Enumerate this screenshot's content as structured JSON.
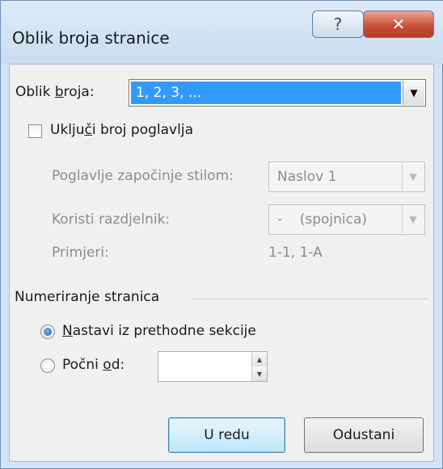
{
  "window": {
    "title": "Oblik broja stranice",
    "help_glyph": "?",
    "close_glyph": "✕"
  },
  "number_format": {
    "label_pre": "Oblik ",
    "label_u": "b",
    "label_post": "roja:",
    "value": "1, 2, 3, ...",
    "arrow": "▼"
  },
  "include_chapter": {
    "label_pre": "Uklju",
    "label_u": "č",
    "label_post": "i broj poglavlja",
    "checked": false
  },
  "chapter_style": {
    "label": "Poglavlje započinje stilom:",
    "value": "Naslov 1",
    "arrow": "▼"
  },
  "separator": {
    "label": "Koristi razdjelnik:",
    "value": "-    (spojnica)",
    "arrow": "▼"
  },
  "examples": {
    "label": "Primjeri:",
    "value": "1-1, 1-A"
  },
  "page_numbering": {
    "heading": "Numeriranje stranica",
    "continue": {
      "label_u": "N",
      "label_post": "astavi iz prethodne sekcije",
      "selected": true
    },
    "start_at": {
      "label_pre": "Počni ",
      "label_u": "o",
      "label_post": "d:",
      "selected": false,
      "value": ""
    }
  },
  "buttons": {
    "ok": "U redu",
    "cancel": "Odustani"
  }
}
